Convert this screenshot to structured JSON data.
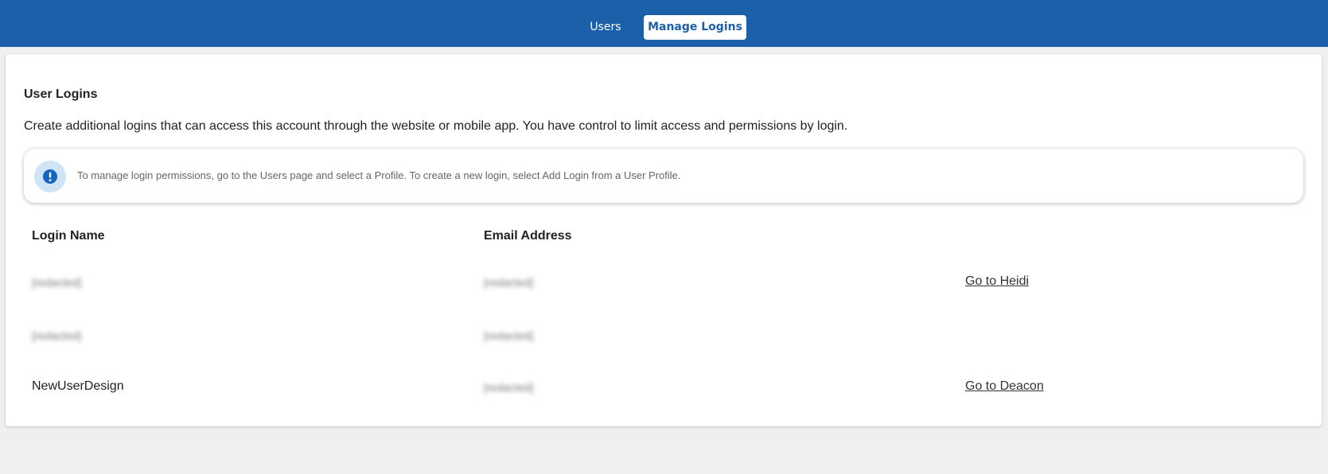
{
  "tabs": [
    {
      "label": "Users",
      "active": false
    },
    {
      "label": "Manage Logins",
      "active": true
    }
  ],
  "section": {
    "title": "User Logins",
    "description": "Create additional logins that can access this account through the website or mobile app. You have control to limit access and permissions by login."
  },
  "info": {
    "icon": "exclamation-icon",
    "text": "To manage login permissions, go to the Users page and select a Profile. To create a new login, select Add Login from a User Profile."
  },
  "table": {
    "headers": [
      "Login Name",
      "Email Address"
    ],
    "rows": [
      {
        "login": "[redacted]",
        "email": "[redacted]",
        "link": "Go to Heidi"
      },
      {
        "login": "[redacted]",
        "email": "[redacted]",
        "link": ""
      },
      {
        "login": "NewUserDesign",
        "email": "[redacted]",
        "link": "Go to Deacon"
      }
    ]
  },
  "colors": {
    "header_bg": "#1c60aa",
    "info_circle_bg": "#cfe5f6",
    "info_icon": "#1565c0"
  }
}
